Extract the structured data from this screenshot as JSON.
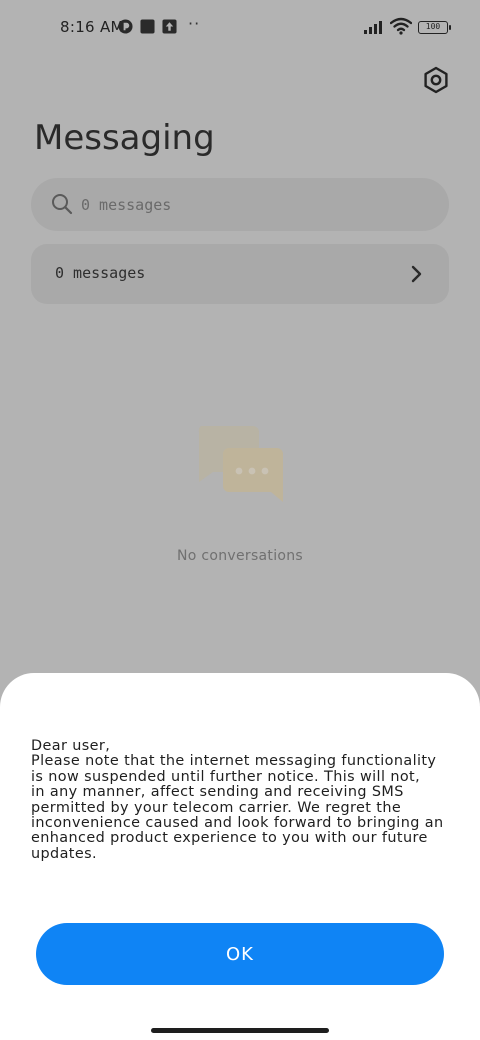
{
  "status_bar": {
    "time": "8:16 AM",
    "notification_icons": [
      "app-icon",
      "square-icon",
      "upload-icon"
    ],
    "more_indicator": "··",
    "battery": "100"
  },
  "header": {
    "title": "Messaging",
    "settings_icon": "gear-icon"
  },
  "search": {
    "placeholder": "0 messages",
    "icon": "search-icon"
  },
  "summary_card": {
    "label": "0 messages",
    "icon": "chevron-right-icon"
  },
  "empty_state": {
    "icon": "chat-bubbles-icon",
    "text": "No conversations"
  },
  "dialog": {
    "message_lines": [
      "Dear user,",
      "Please note that the internet messaging functionality",
      "is now suspended until further notice. This will not,",
      "in any manner, affect sending and receiving SMS",
      "permitted by your telecom carrier. We regret the",
      "inconvenience caused and look forward to bringing an",
      "enhanced product experience to you with our future",
      "updates."
    ],
    "ok_label": "OK"
  },
  "colors": {
    "scrim_background": "#b3b3b3",
    "card_background": "#a9a9a9",
    "accent": "#0f84f5",
    "sheet_background": "#ffffff"
  }
}
